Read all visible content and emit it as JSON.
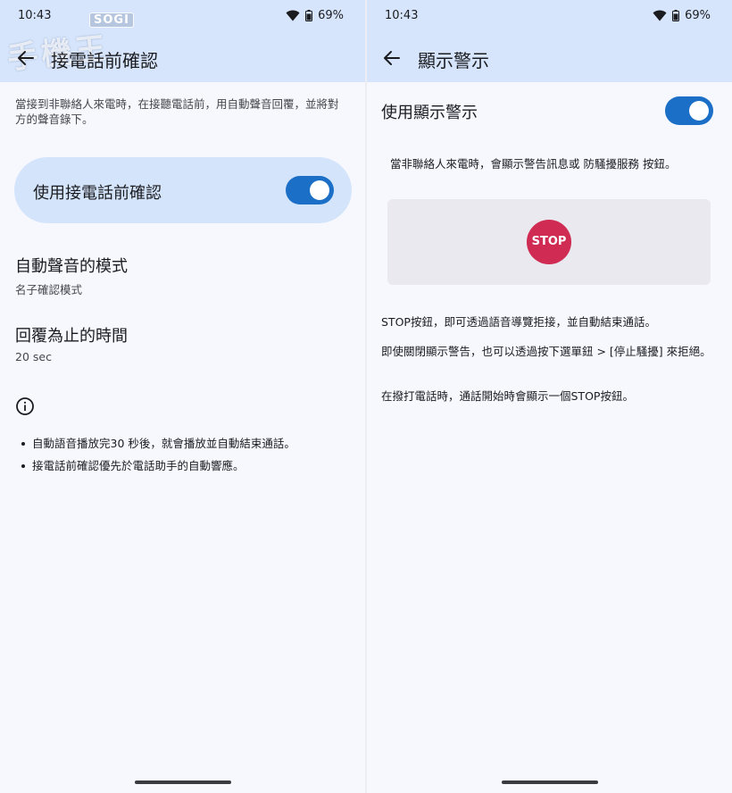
{
  "left": {
    "status": {
      "time": "10:43",
      "battery": "69%"
    },
    "watermark": {
      "brand": "SOGI",
      "text": "手機王"
    },
    "title": "接電話前確認",
    "description": "當接到非聯絡人來電時，在接聽電話前，用自動聲音回覆，並將對方的聲音錄下。",
    "toggle": {
      "label": "使用接電話前確認",
      "on": true
    },
    "settings": [
      {
        "name": "自動聲音的模式",
        "value": "名子確認模式"
      },
      {
        "name": "回覆為止的時間",
        "value": "20 sec"
      }
    ],
    "notes": [
      "自動語音播放完30 秒後，就會播放並自動結束通話。",
      "接電話前確認優先於電話助手的自動響應。"
    ]
  },
  "right": {
    "status": {
      "time": "10:43",
      "battery": "69%"
    },
    "title": "顯示警示",
    "toggle": {
      "label": "使用顯示警示",
      "on": true
    },
    "description": "當非聯絡人來電時，會顯示警告訊息或 防騷擾服務 按鈕。",
    "stop_button_label": "STOP",
    "paragraphs": [
      "STOP按鈕，即可透過語音導覽拒接，並自動結束通話。",
      "即使關閉顯示警告，也可以透過按下選單鈕 > [停止騷擾] 來拒絕。",
      "在撥打電話時，通話開始時會顯示一個STOP按鈕。"
    ]
  },
  "colors": {
    "appbar": "#d6e5fb",
    "toggle_track": "#1b6fc6",
    "stop_button": "#d02b52",
    "background": "#f7f8fd"
  },
  "icons": {
    "back": "arrow-left-icon",
    "wifi": "wifi-icon",
    "battery": "battery-icon",
    "info": "info-icon"
  }
}
